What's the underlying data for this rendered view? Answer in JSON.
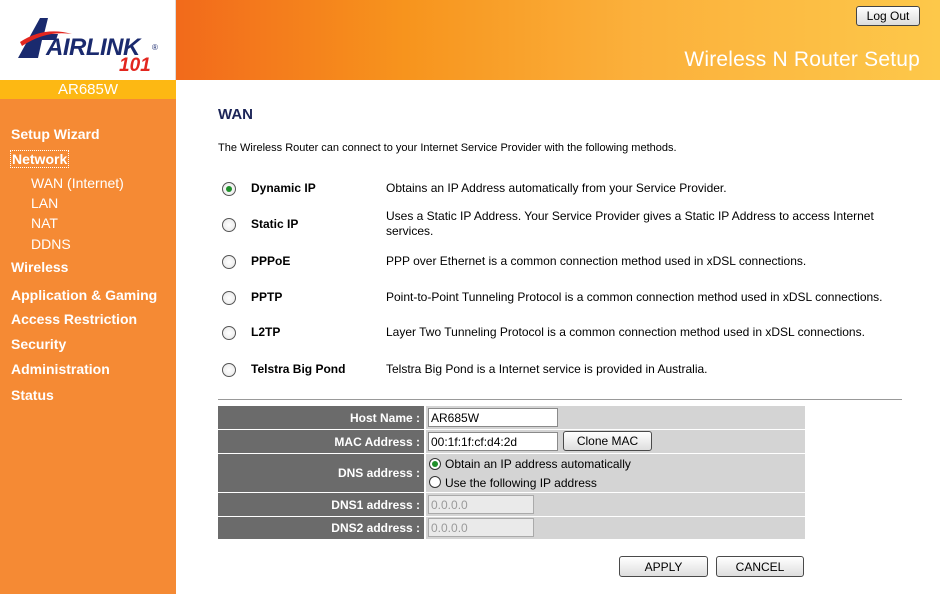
{
  "brand": {
    "logo_word": "AIRLINK",
    "logo_number": "101",
    "registered": "®",
    "model": "AR685W"
  },
  "header": {
    "title": "Wireless N Router Setup",
    "logout_label": "Log Out"
  },
  "sidebar": {
    "items": [
      {
        "label": "Setup Wizard"
      },
      {
        "label": "Network",
        "active": true,
        "children": [
          {
            "label": "WAN (Internet)"
          },
          {
            "label": "LAN"
          },
          {
            "label": "NAT"
          },
          {
            "label": "DDNS"
          }
        ]
      },
      {
        "label": "Wireless"
      },
      {
        "label": "Application & Gaming"
      },
      {
        "label": "Access Restriction"
      },
      {
        "label": "Security"
      },
      {
        "label": "Administration"
      },
      {
        "label": "Status"
      }
    ]
  },
  "main": {
    "heading": "WAN",
    "intro": "The Wireless Router can connect to your Internet Service Provider with the following methods.",
    "methods": [
      {
        "name": "Dynamic IP",
        "description": "Obtains an IP Address automatically from your Service Provider.",
        "selected": true
      },
      {
        "name": "Static IP",
        "description": "Uses a Static IP Address. Your Service Provider gives a Static IP Address to access Internet services.",
        "selected": false
      },
      {
        "name": "PPPoE",
        "description": "PPP over Ethernet is a common connection method used in xDSL connections.",
        "selected": false
      },
      {
        "name": "PPTP",
        "description": "Point-to-Point Tunneling Protocol is a common connection method used in xDSL connections.",
        "selected": false
      },
      {
        "name": "L2TP",
        "description": "Layer Two Tunneling Protocol is a common connection method used in xDSL connections.",
        "selected": false
      },
      {
        "name": "Telstra Big Pond",
        "description": "Telstra Big Pond is a Internet service is provided in Australia.",
        "selected": false
      }
    ],
    "form": {
      "host_name_label": "Host Name :",
      "host_name_value": "AR685W",
      "mac_label": "MAC Address :",
      "mac_value": "00:1f:1f:cf:d4:2d",
      "clone_mac_label": "Clone MAC",
      "dns_label": "DNS address :",
      "dns_auto_label": "Obtain an IP address automatically",
      "dns_manual_label": "Use the following IP address",
      "dns_mode": "auto",
      "dns1_label": "DNS1 address :",
      "dns1_value": "0.0.0.0",
      "dns2_label": "DNS2 address :",
      "dns2_value": "0.0.0.0"
    },
    "apply_label": "APPLY",
    "cancel_label": "CANCEL"
  },
  "colors": {
    "sidebar": "#f58a34",
    "model_bar": "#fdb813",
    "header_gradient_start": "#f26a1b",
    "header_gradient_end": "#fdc84a",
    "label_cell": "#6b6b6b",
    "value_cell": "#d4d4d4",
    "heading": "#1b2457"
  }
}
